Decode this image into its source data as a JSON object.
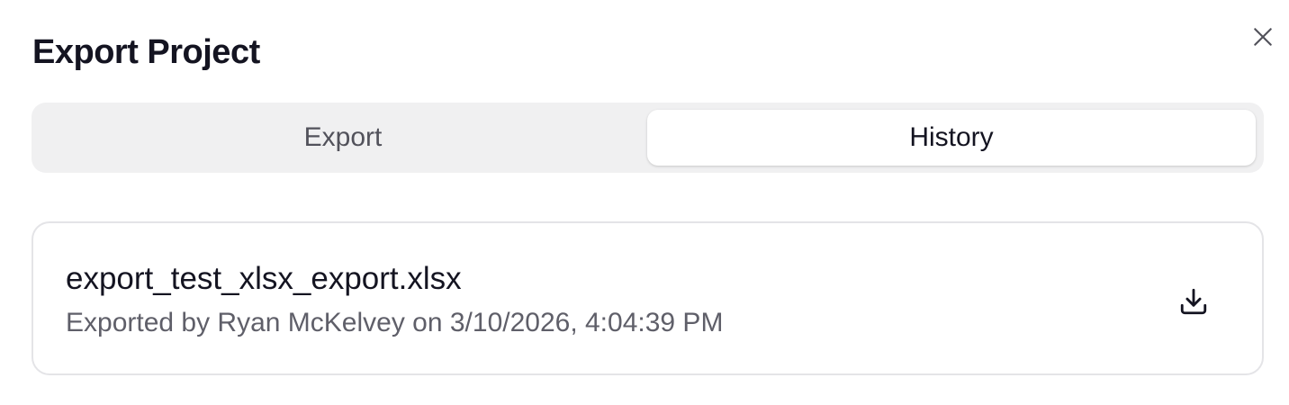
{
  "dialog": {
    "title": "Export Project",
    "close_icon": "close-icon"
  },
  "tabs": [
    {
      "label": "Export",
      "active": false
    },
    {
      "label": "History",
      "active": true
    }
  ],
  "history": {
    "items": [
      {
        "file_name": "export_test_xlsx_export.xlsx",
        "meta": "Exported by Ryan McKelvey on 3/10/2026, 4:04:39 PM",
        "action_icon": "download-icon"
      }
    ]
  },
  "colors": {
    "text_primary": "#141421",
    "text_secondary": "#5f5f69",
    "tab_track": "#f0f0f1",
    "card_border": "#e4e4e7"
  }
}
